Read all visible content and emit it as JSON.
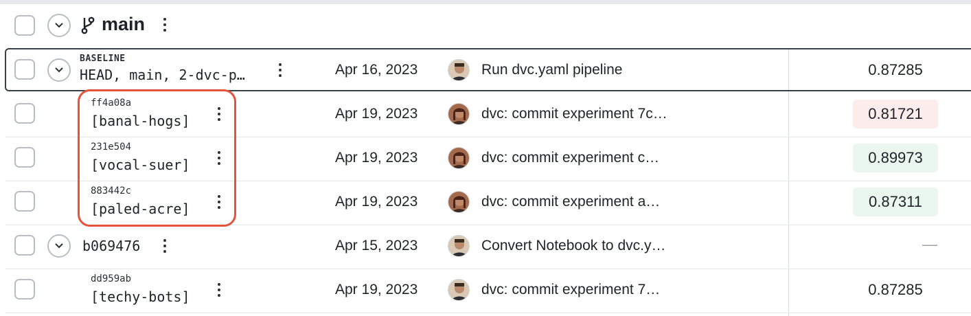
{
  "branch": {
    "name": "main",
    "icon": "git-branch-icon"
  },
  "baseline": {
    "badge": "BASELINE",
    "label": "HEAD, main, 2-dvc-p…",
    "date": "Apr 16, 2023",
    "message": "Run dvc.yaml pipeline",
    "metric": "0.87285"
  },
  "experiments": [
    {
      "sha": "ff4a08a",
      "name": "[banal-hogs]",
      "date": "Apr 19, 2023",
      "message": "dvc: commit experiment 7c…",
      "metric": "0.81721",
      "metric_status": "worse"
    },
    {
      "sha": "231e504",
      "name": "[vocal-suer]",
      "date": "Apr 19, 2023",
      "message": "dvc: commit experiment c…",
      "metric": "0.89973",
      "metric_status": "better"
    },
    {
      "sha": "883442c",
      "name": "[paled-acre]",
      "date": "Apr 19, 2023",
      "message": "dvc: commit experiment a…",
      "metric": "0.87311",
      "metric_status": "better"
    }
  ],
  "commit": {
    "sha": "b069476",
    "date": "Apr 15, 2023",
    "message": "Convert Notebook to dvc.y…",
    "metric": "—"
  },
  "commit_experiments": [
    {
      "sha": "dd959ab",
      "name": "[techy-bots]",
      "date": "Apr 19, 2023",
      "message": "dvc: commit experiment 7…",
      "metric": "0.87285"
    }
  ],
  "colors": {
    "highlight": "#e5533a",
    "worse": "#fdecec",
    "better": "#eaf7ee"
  }
}
